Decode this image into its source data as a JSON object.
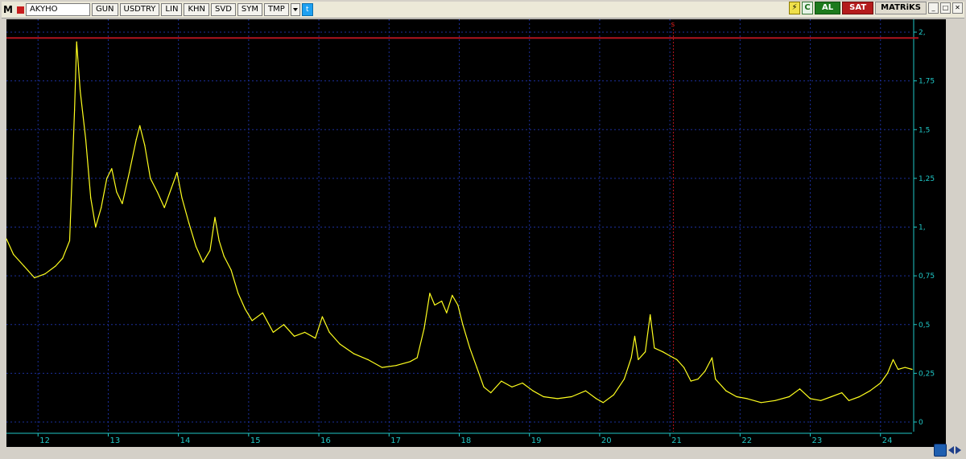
{
  "toolbar": {
    "app_letter": "M",
    "symbol": "AKYHO",
    "buttons": [
      "GUN",
      "USDTRY",
      "LIN",
      "KHN",
      "SVD",
      "SYM",
      "TMP"
    ],
    "buy_label": "AL",
    "sell_label": "SAT",
    "brand": "MATRiKS",
    "refresh_glyph": "C",
    "lightning_glyph": "⚡",
    "win_buttons": [
      "_",
      "□",
      "✕"
    ]
  },
  "marker": {
    "label": "s"
  },
  "colors": {
    "background": "#000000",
    "line": "#ffff1e",
    "grid": "#1c2f9a",
    "axis_text": "#1fc8c8",
    "ref_line": "#b0141e"
  },
  "chart_data": {
    "type": "line",
    "x_ticks": [
      "12",
      "13",
      "14",
      "15",
      "16",
      "17",
      "18",
      "19",
      "20",
      "21",
      "22",
      "23",
      "24"
    ],
    "y_ticks": [
      "0",
      "0,25",
      "0,5",
      "0,75",
      "1,",
      "1,25",
      "1,5",
      "1,75",
      "2,"
    ],
    "ylim": [
      0,
      2
    ],
    "xlim": [
      11.55,
      24.45
    ],
    "horizontal_line": 1.97,
    "vertical_marker_x": 21.05,
    "grid": true,
    "points": [
      [
        11.55,
        0.94
      ],
      [
        11.65,
        0.86
      ],
      [
        11.8,
        0.8
      ],
      [
        11.95,
        0.74
      ],
      [
        12.1,
        0.76
      ],
      [
        12.25,
        0.8
      ],
      [
        12.35,
        0.84
      ],
      [
        12.45,
        0.93
      ],
      [
        12.52,
        1.6
      ],
      [
        12.55,
        1.95
      ],
      [
        12.6,
        1.7
      ],
      [
        12.68,
        1.45
      ],
      [
        12.75,
        1.15
      ],
      [
        12.82,
        1.0
      ],
      [
        12.9,
        1.1
      ],
      [
        12.98,
        1.25
      ],
      [
        13.05,
        1.3
      ],
      [
        13.12,
        1.18
      ],
      [
        13.2,
        1.12
      ],
      [
        13.3,
        1.28
      ],
      [
        13.4,
        1.45
      ],
      [
        13.45,
        1.52
      ],
      [
        13.52,
        1.42
      ],
      [
        13.6,
        1.25
      ],
      [
        13.7,
        1.18
      ],
      [
        13.8,
        1.1
      ],
      [
        13.9,
        1.2
      ],
      [
        13.98,
        1.28
      ],
      [
        14.05,
        1.15
      ],
      [
        14.15,
        1.02
      ],
      [
        14.25,
        0.9
      ],
      [
        14.35,
        0.82
      ],
      [
        14.45,
        0.88
      ],
      [
        14.52,
        1.05
      ],
      [
        14.58,
        0.93
      ],
      [
        14.65,
        0.85
      ],
      [
        14.75,
        0.78
      ],
      [
        14.85,
        0.66
      ],
      [
        14.95,
        0.58
      ],
      [
        15.05,
        0.52
      ],
      [
        15.2,
        0.56
      ],
      [
        15.35,
        0.46
      ],
      [
        15.5,
        0.5
      ],
      [
        15.65,
        0.44
      ],
      [
        15.8,
        0.46
      ],
      [
        15.95,
        0.43
      ],
      [
        16.05,
        0.54
      ],
      [
        16.15,
        0.46
      ],
      [
        16.3,
        0.4
      ],
      [
        16.5,
        0.35
      ],
      [
        16.7,
        0.32
      ],
      [
        16.9,
        0.28
      ],
      [
        17.1,
        0.29
      ],
      [
        17.3,
        0.31
      ],
      [
        17.4,
        0.33
      ],
      [
        17.5,
        0.48
      ],
      [
        17.58,
        0.66
      ],
      [
        17.65,
        0.6
      ],
      [
        17.75,
        0.62
      ],
      [
        17.82,
        0.56
      ],
      [
        17.9,
        0.65
      ],
      [
        17.98,
        0.6
      ],
      [
        18.05,
        0.5
      ],
      [
        18.15,
        0.38
      ],
      [
        18.25,
        0.28
      ],
      [
        18.35,
        0.18
      ],
      [
        18.45,
        0.15
      ],
      [
        18.6,
        0.21
      ],
      [
        18.75,
        0.18
      ],
      [
        18.9,
        0.2
      ],
      [
        19.05,
        0.16
      ],
      [
        19.2,
        0.13
      ],
      [
        19.4,
        0.12
      ],
      [
        19.6,
        0.13
      ],
      [
        19.8,
        0.16
      ],
      [
        19.95,
        0.12
      ],
      [
        20.05,
        0.1
      ],
      [
        20.2,
        0.14
      ],
      [
        20.35,
        0.22
      ],
      [
        20.45,
        0.33
      ],
      [
        20.5,
        0.44
      ],
      [
        20.55,
        0.32
      ],
      [
        20.65,
        0.36
      ],
      [
        20.72,
        0.55
      ],
      [
        20.78,
        0.38
      ],
      [
        20.9,
        0.36
      ],
      [
        21.0,
        0.34
      ],
      [
        21.1,
        0.32
      ],
      [
        21.2,
        0.28
      ],
      [
        21.3,
        0.21
      ],
      [
        21.4,
        0.22
      ],
      [
        21.5,
        0.26
      ],
      [
        21.6,
        0.33
      ],
      [
        21.65,
        0.22
      ],
      [
        21.8,
        0.16
      ],
      [
        21.95,
        0.13
      ],
      [
        22.1,
        0.12
      ],
      [
        22.3,
        0.1
      ],
      [
        22.5,
        0.11
      ],
      [
        22.7,
        0.13
      ],
      [
        22.85,
        0.17
      ],
      [
        23.0,
        0.12
      ],
      [
        23.15,
        0.11
      ],
      [
        23.3,
        0.13
      ],
      [
        23.45,
        0.15
      ],
      [
        23.55,
        0.11
      ],
      [
        23.7,
        0.13
      ],
      [
        23.85,
        0.16
      ],
      [
        24.0,
        0.2
      ],
      [
        24.1,
        0.25
      ],
      [
        24.18,
        0.32
      ],
      [
        24.25,
        0.27
      ],
      [
        24.35,
        0.28
      ],
      [
        24.45,
        0.27
      ]
    ]
  }
}
